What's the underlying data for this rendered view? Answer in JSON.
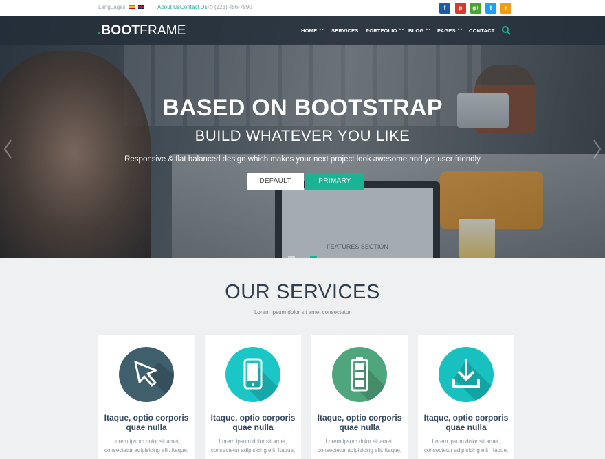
{
  "topbar": {
    "languages_label": "Languages:",
    "links": [
      "About Us",
      "Contact Us"
    ],
    "phone": "(123) 456-7890",
    "social": [
      {
        "name": "facebook",
        "glyph": "f",
        "color": "#1f5aa6"
      },
      {
        "name": "google-plus-p",
        "glyph": "p",
        "color": "#d33b2c"
      },
      {
        "name": "google-plus",
        "glyph": "g+",
        "color": "#49a52f"
      },
      {
        "name": "twitter",
        "glyph": "t",
        "color": "#1da1f2"
      },
      {
        "name": "rss",
        "glyph": "r",
        "color": "#f39c12"
      }
    ]
  },
  "navbar": {
    "logo_dot": ".",
    "logo_bold": "BOOT",
    "logo_rest": "FRAME",
    "items": [
      {
        "label": "HOME",
        "dropdown": true
      },
      {
        "label": "SERVICES",
        "dropdown": false
      },
      {
        "label": "PORTFOLIO",
        "dropdown": true
      },
      {
        "label": "BLOG",
        "dropdown": true
      },
      {
        "label": "PAGES",
        "dropdown": true
      },
      {
        "label": "CONTACT",
        "dropdown": false
      }
    ],
    "chevron": "⌄",
    "search_icon": "search-icon"
  },
  "hero": {
    "title": "BASED ON BOOTSTRAP",
    "subtitle": "BUILD WHATEVER YOU LIKE",
    "tagline": "Responsive & flat balanced design which makes your next project look awesome and yet user friendly",
    "button_default": "DEFAULT",
    "button_primary": "PRIMARY",
    "laptop_text": "FEATURES SECTION",
    "accent": "#1ab394"
  },
  "services": {
    "title": "OUR SERVICES",
    "subtitle": "Lorem ipsum dolor sit amet consectetur",
    "cards": [
      {
        "icon": "cursor-icon",
        "color": "#3f5f6d",
        "title_line1": "Itaque, optio corporis",
        "title_line2": "quae nulla",
        "text_line1": "Lorem ipsum dolor sit amet,",
        "text_line2": "consectetur adipisicing elit. Itaque,"
      },
      {
        "icon": "phone-icon",
        "color": "#1bc6c6",
        "title_line1": "Itaque, optio corporis",
        "title_line2": "quae nulla",
        "text_line1": "Lorem ipsum dolor sit amet,",
        "text_line2": "consectetur adipisicing elit. Itaque,"
      },
      {
        "icon": "battery-icon",
        "color": "#4fa57c",
        "title_line1": "Itaque, optio corporis",
        "title_line2": "quae nulla",
        "text_line1": "Lorem ipsum dolor sit amet,",
        "text_line2": "consectetur adipisicing elit. Itaque,"
      },
      {
        "icon": "download-icon",
        "color": "#18c0c0",
        "title_line1": "Itaque, optio corporis",
        "title_line2": "quae nulla",
        "text_line1": "Lorem ipsum dolor sit amet,",
        "text_line2": "consectetur adipisicing elit. Itaque,"
      }
    ]
  }
}
